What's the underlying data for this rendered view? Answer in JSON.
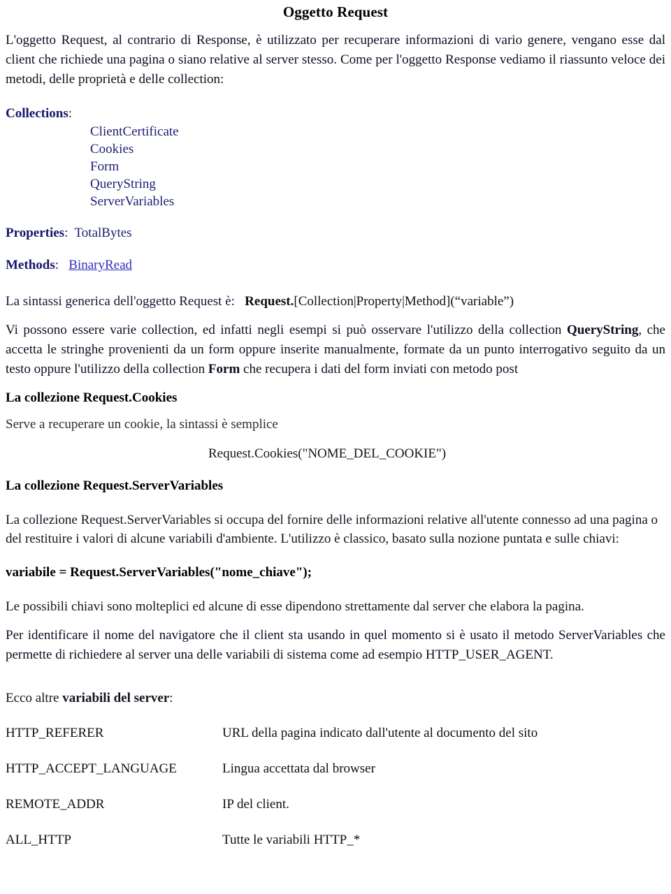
{
  "document": {
    "title_prefix": "Oggetto ",
    "title_strong": "Request",
    "intro_paragraph": "L'oggetto Request, al contrario di Response, è utilizzato per recuperare informazioni di vario genere, vengano esse dal client che richiede una pagina o siano relative al server stesso. Come per l'oggetto Response vediamo il riassunto veloce dei metodi, delle proprietà e delle collection:"
  },
  "reference": {
    "collections_label": "Collections",
    "collections_colon": ":",
    "collections": [
      "ClientCertificate",
      "Cookies",
      "Form",
      "QueryString",
      "ServerVariables"
    ],
    "properties_label": "Properties",
    "properties_colon": ":",
    "properties_value": "TotalBytes",
    "methods_label": "Methods",
    "methods_colon": ":",
    "methods_value": "BinaryRead"
  },
  "syntax": {
    "lead": "La sintassi generica dell'oggetto Request è:",
    "code_strong": "Request.",
    "code_rest": "[Collection|Property|Method](“variable”)"
  },
  "collections_paragraph": {
    "part1": "Vi possono essere varie collection, ed infatti  negli esempi si può osservare l'utilizzo della collection ",
    "bold1": "QueryString",
    "part2": ", che accetta le stringhe provenienti da un form oppure inserite manualmente, formate da un punto interrogativo seguito da un testo oppure l'utilizzo della collection ",
    "bold2": "Form",
    "part3": " che recupera i dati del form inviati con metodo post"
  },
  "cookies_section": {
    "heading": "La collezione Request.Cookies",
    "description": "Serve a recuperare un cookie, la sintassi è semplice",
    "code": "Request.Cookies(\"NOME_DEL_COOKIE\")"
  },
  "servervariables_section": {
    "heading": "La collezione Request.ServerVariables",
    "description": "La collezione Request.ServerVariables si occupa del fornire delle informazioni relative all'utente connesso ad una pagina o del restituire i valori di alcune variabili d'ambiente. L'utilizzo è classico, basato sulla nozione puntata e sulle chiavi:",
    "syntax": "variabile = Request.ServerVariables(\"nome_chiave\");",
    "keys_note": "Le possibili chiavi sono molteplici ed alcune di esse dipendono strettamente dal server che elabora la pagina.",
    "user_agent_note": "Per identificare il nome del navigatore che il client sta usando in quel momento si è usato il metodo ServerVariables che permette di richiedere al server una delle variabili di sistema come ad esempio HTTP_USER_AGENT."
  },
  "server_vars": {
    "lead_prefix": "Ecco altre ",
    "lead_strong": "variabili del server",
    "lead_suffix": ":",
    "rows": [
      {
        "name": "HTTP_REFERER",
        "desc": "URL  della pagina indicato dall'utente al documento del sito"
      },
      {
        "name": "HTTP_ACCEPT_LANGUAGE",
        "desc": "Lingua accettata dal browser"
      },
      {
        "name": "REMOTE_ADDR",
        "desc": "IP  del client."
      },
      {
        "name": "ALL_HTTP",
        "desc": "Tutte le variabili HTTP_*"
      }
    ]
  },
  "colors": {
    "navy_heading": "#16166b",
    "navy_item": "#1d1d72",
    "link_blue": "#2f2fbe",
    "body_text": "#0d0d21"
  }
}
